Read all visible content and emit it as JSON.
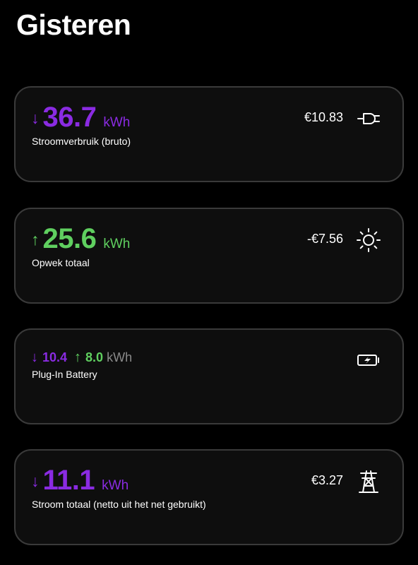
{
  "page": {
    "title": "Gisteren"
  },
  "cards": [
    {
      "arrow": "↓",
      "value": "36.7",
      "unit": "kWh",
      "label": "Stroomverbruik (bruto)",
      "price": "€10.83",
      "icon": "plug-icon",
      "accent": "#8a2be2"
    },
    {
      "arrow": "↑",
      "value": "25.6",
      "unit": "kWh",
      "label": "Opwek totaal",
      "price": "-€7.56",
      "icon": "sun-icon",
      "accent": "#5fcf5f"
    },
    {
      "down_arrow": "↓",
      "down_value": "10.4",
      "up_arrow": "↑",
      "up_value": "8.0",
      "unit": "kWh",
      "label": "Plug-In Battery",
      "icon": "battery-charging-icon"
    },
    {
      "arrow": "↓",
      "value": "11.1",
      "unit": "kWh",
      "label": "Stroom totaal (netto uit het net gebruikt)",
      "price": "€3.27",
      "icon": "power-pylon-icon",
      "accent": "#8a2be2"
    }
  ]
}
